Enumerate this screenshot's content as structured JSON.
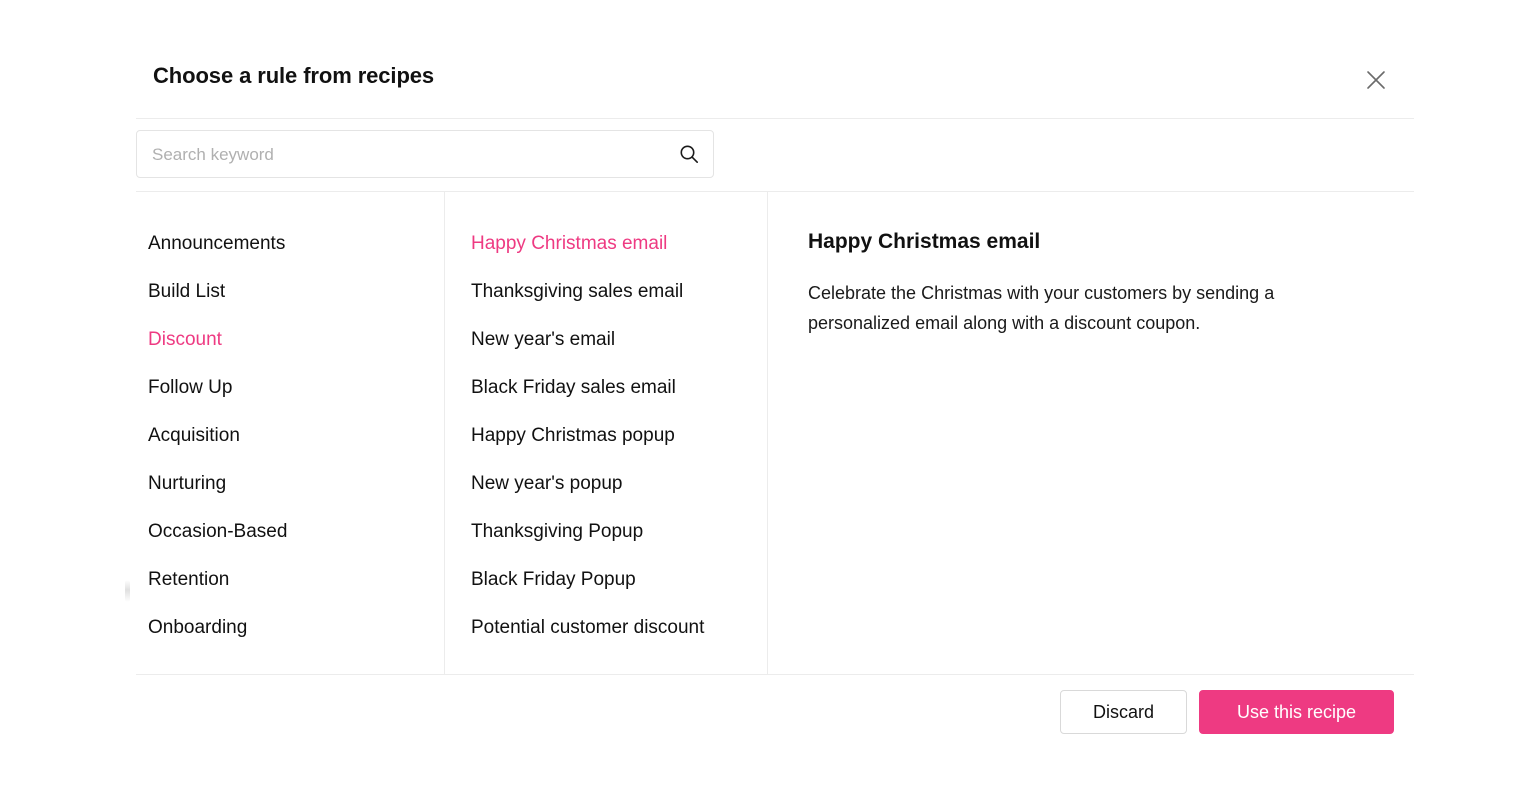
{
  "dialog": {
    "title": "Choose a rule from recipes",
    "close_icon": "close-icon"
  },
  "search": {
    "placeholder": "Search keyword",
    "value": "",
    "icon": "search-icon"
  },
  "categories": {
    "selected": "Discount",
    "items": [
      {
        "label": "Announcements",
        "selected": false
      },
      {
        "label": "Build List",
        "selected": false
      },
      {
        "label": "Discount",
        "selected": true
      },
      {
        "label": "Follow Up",
        "selected": false
      },
      {
        "label": "Acquisition",
        "selected": false
      },
      {
        "label": "Nurturing",
        "selected": false
      },
      {
        "label": "Occasion-Based",
        "selected": false
      },
      {
        "label": "Retention",
        "selected": false
      },
      {
        "label": "Onboarding",
        "selected": false
      }
    ]
  },
  "recipes": {
    "selected": "Happy Christmas email",
    "items": [
      {
        "label": "Happy Christmas email",
        "selected": true
      },
      {
        "label": "Thanksgiving sales email",
        "selected": false
      },
      {
        "label": "New year's email",
        "selected": false
      },
      {
        "label": "Black Friday sales email",
        "selected": false
      },
      {
        "label": "Happy Christmas popup",
        "selected": false
      },
      {
        "label": "New year's popup",
        "selected": false
      },
      {
        "label": "Thanksgiving Popup",
        "selected": false
      },
      {
        "label": "Black Friday Popup",
        "selected": false
      },
      {
        "label": "Potential customer discount",
        "selected": false
      }
    ]
  },
  "detail": {
    "title": "Happy Christmas email",
    "description": "Celebrate the Christmas with your customers by sending a personalized email along with a discount coupon."
  },
  "footer": {
    "discard_label": "Discard",
    "primary_label": "Use this recipe"
  },
  "colors": {
    "accent": "#ee3a82",
    "text": "#111111",
    "placeholder": "#b0b0b0",
    "divider": "#ececec",
    "input_border": "#e4e4e4",
    "button_border": "#d9d9d9"
  }
}
